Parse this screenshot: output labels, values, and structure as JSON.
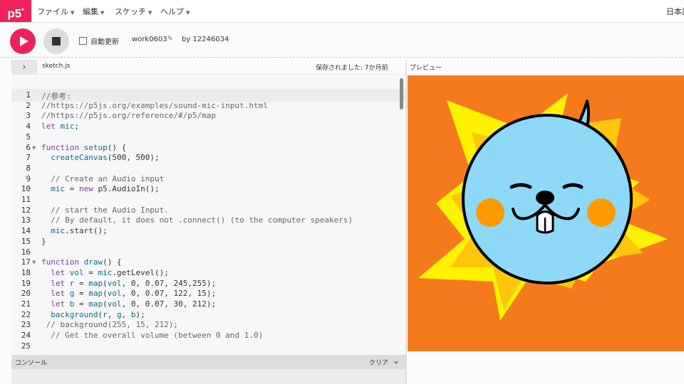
{
  "app": {
    "logo": "p5",
    "logo_sup": "*"
  },
  "menu": {
    "items": [
      "ファイル",
      "編集",
      "スケッチ",
      "ヘルプ"
    ],
    "language": "日本語"
  },
  "toolbar": {
    "autorefresh_label": "自動更新",
    "sketch_name": "work0603",
    "byline": "by 12246034"
  },
  "editor": {
    "collapse_icon": "›",
    "file_name": "sketch.js",
    "saved_status": "保存されました: 7か月前",
    "lines": [
      "//参考:",
      "//https://p5js.org/examples/sound-mic-input.html",
      "//https://p5js.org/reference/#/p5/map",
      "let mic;",
      "",
      "function setup() {",
      "  createCanvas(500, 500);",
      "",
      "  // Create an Audio input",
      "  mic = new p5.AudioIn();",
      "",
      "  // start the Audio Input.",
      "  // By default, it does not .connect() (to the computer speakers)",
      "  mic.start();",
      "}",
      "",
      "function draw() {",
      "  let vol = mic.getLevel();",
      "  let r = map(vol, 0, 0.07, 245,255);",
      "  let g = map(vol, 0, 0.07, 122, 15);",
      "  let b = map(vol, 0, 0.07, 30, 212);",
      "  background(r, g, b);",
      " // background(255, 15, 212);",
      "  // Get the overall volume (between 0 and 1.0)",
      ""
    ],
    "folded_lines": [
      6,
      17
    ]
  },
  "console": {
    "label": "コンソール",
    "clear": "クリア"
  },
  "preview": {
    "label": "プレビュー",
    "background_color": "#f57a1e",
    "star_color_outer": "#fff200",
    "star_color_inner": "#ffc60b",
    "face_color": "#8ed8f8",
    "cheek_color": "#ff9900"
  },
  "colors": {
    "accent": "#ed225d"
  }
}
